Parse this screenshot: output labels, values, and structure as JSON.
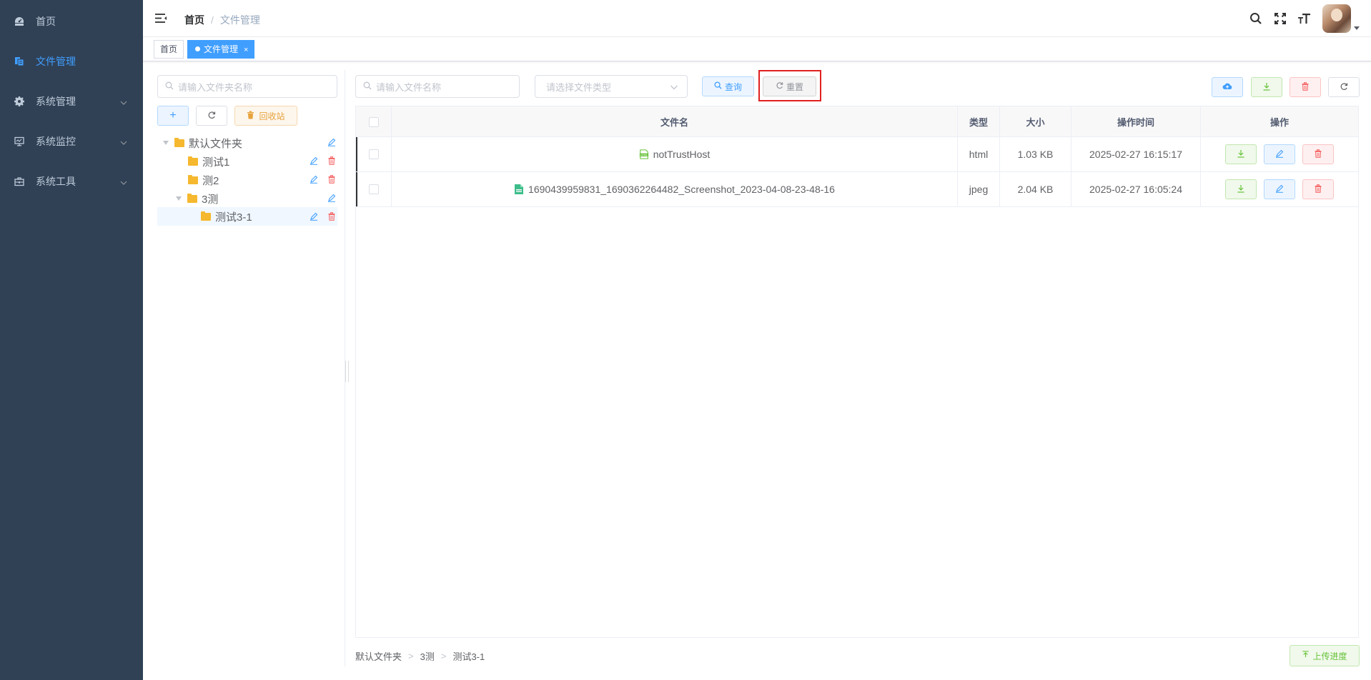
{
  "sidebar": {
    "items": [
      {
        "label": "首页",
        "icon": "dashboard-icon"
      },
      {
        "label": "文件管理",
        "icon": "documents-icon"
      },
      {
        "label": "系统管理",
        "icon": "gear-icon"
      },
      {
        "label": "系统监控",
        "icon": "monitor-icon"
      },
      {
        "label": "系统工具",
        "icon": "toolbox-icon"
      }
    ],
    "active_color": "#409eff",
    "background": "#304156"
  },
  "navbar": {
    "breadcrumb": [
      "首页",
      "/",
      "文件管理"
    ]
  },
  "tags": [
    {
      "label": "首页"
    },
    {
      "label": "文件管理",
      "close": "×"
    }
  ],
  "tree": {
    "search_placeholder": "请输入文件夹名称",
    "recycle_label": "回收站",
    "add_label": "+",
    "nodes": [
      {
        "label": "默认文件夹"
      },
      {
        "label": "测试1"
      },
      {
        "label": "测2"
      },
      {
        "label": "3测"
      },
      {
        "label": "测试3-1"
      }
    ]
  },
  "filters": {
    "name_placeholder": "请输入文件名称",
    "type_placeholder": "请选择文件类型",
    "search_label": "查询",
    "reset_label": "重置"
  },
  "table": {
    "columns": [
      "文件名",
      "类型",
      "大小",
      "操作时间",
      "操作"
    ],
    "rows": [
      {
        "name": "notTrustHost",
        "type": "html",
        "size": "1.03 KB",
        "time": "2025-02-27 16:15:17"
      },
      {
        "name": "1690439959831_1690362264482_Screenshot_2023-04-08-23-48-16",
        "type": "jpeg",
        "size": "2.04 KB",
        "time": "2025-02-27 16:05:24"
      }
    ]
  },
  "footer": {
    "path": [
      "默认文件夹",
      ">",
      "3测",
      ">",
      "测试3-1"
    ],
    "upload_progress_label": "上传进度"
  },
  "colors": {
    "primary": "#409eff",
    "success": "#67c23a",
    "danger": "#f56c6c",
    "warning": "#e6a23c",
    "highlight_box": "#e02020"
  }
}
